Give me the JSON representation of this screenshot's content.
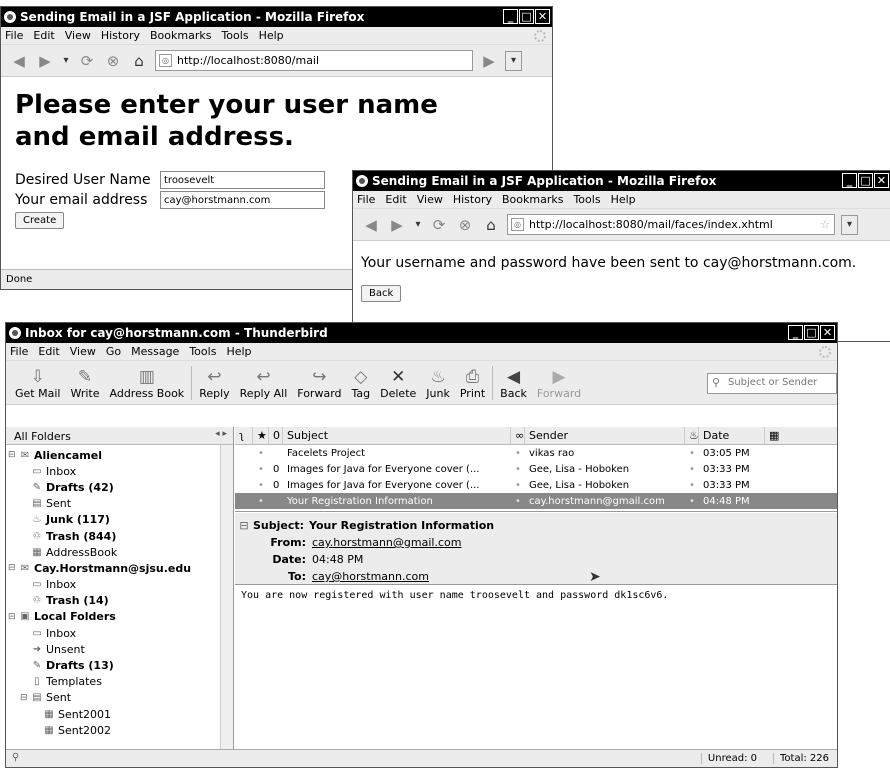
{
  "ff1": {
    "title": "Sending Email in a JSF Application - Mozilla Firefox",
    "menu": [
      "File",
      "Edit",
      "View",
      "History",
      "Bookmarks",
      "Tools",
      "Help"
    ],
    "url": "http://localhost:8080/mail",
    "heading_line1": "Please enter your user name",
    "heading_line2": "and email address.",
    "username_label": "Desired User Name",
    "username_value": "troosevelt",
    "email_label": "Your email address",
    "email_value": "cay@horstmann.com",
    "create_button": "Create",
    "status": "Done"
  },
  "ff2": {
    "title": "Sending Email in a JSF Application - Mozilla Firefox",
    "menu": [
      "File",
      "Edit",
      "View",
      "History",
      "Bookmarks",
      "Tools",
      "Help"
    ],
    "url": "http://localhost:8080/mail/faces/index.xhtml",
    "message": "Your username and password have been sent to cay@horstmann.com.",
    "back_button": "Back"
  },
  "tb": {
    "title": "Inbox for cay@horstmann.com - Thunderbird",
    "menu": [
      "File",
      "Edit",
      "View",
      "Go",
      "Message",
      "Tools",
      "Help"
    ],
    "toolbar": {
      "get_mail": "Get Mail",
      "write": "Write",
      "address_book": "Address Book",
      "reply": "Reply",
      "reply_all": "Reply All",
      "forward": "Forward",
      "tag": "Tag",
      "delete": "Delete",
      "junk": "Junk",
      "print": "Print",
      "back": "Back",
      "forward_nav": "Forward",
      "search_placeholder": "Subject or Sender"
    },
    "folders_header": "All Folders",
    "folders": [
      {
        "label": "Aliencamel",
        "bold": true,
        "level": 0,
        "tw": "⊟",
        "icon": "✉"
      },
      {
        "label": "Inbox",
        "bold": false,
        "level": 1,
        "tw": "",
        "icon": "▭"
      },
      {
        "label": "Drafts (42)",
        "bold": true,
        "level": 1,
        "tw": "",
        "icon": "✎"
      },
      {
        "label": "Sent",
        "bold": false,
        "level": 1,
        "tw": "",
        "icon": "▤"
      },
      {
        "label": "Junk (117)",
        "bold": true,
        "level": 1,
        "tw": "",
        "icon": "♨"
      },
      {
        "label": "Trash (844)",
        "bold": true,
        "level": 1,
        "tw": "",
        "icon": "♲"
      },
      {
        "label": "AddressBook",
        "bold": false,
        "level": 1,
        "tw": "",
        "icon": "▦"
      },
      {
        "label": "Cay.Horstmann@sjsu.edu",
        "bold": true,
        "level": 0,
        "tw": "⊟",
        "icon": "✉"
      },
      {
        "label": "Inbox",
        "bold": false,
        "level": 1,
        "tw": "",
        "icon": "▭"
      },
      {
        "label": "Trash (14)",
        "bold": true,
        "level": 1,
        "tw": "",
        "icon": "♲"
      },
      {
        "label": "Local Folders",
        "bold": true,
        "level": 0,
        "tw": "⊟",
        "icon": "▣"
      },
      {
        "label": "Inbox",
        "bold": false,
        "level": 1,
        "tw": "",
        "icon": "▭"
      },
      {
        "label": "Unsent",
        "bold": false,
        "level": 1,
        "tw": "",
        "icon": "➜"
      },
      {
        "label": "Drafts (13)",
        "bold": true,
        "level": 1,
        "tw": "",
        "icon": "✎"
      },
      {
        "label": "Templates",
        "bold": false,
        "level": 1,
        "tw": "",
        "icon": "▯"
      },
      {
        "label": "Sent",
        "bold": false,
        "level": 1,
        "tw": "⊟",
        "icon": "▤"
      },
      {
        "label": "Sent2001",
        "bold": false,
        "level": 2,
        "tw": "",
        "icon": "▦"
      },
      {
        "label": "Sent2002",
        "bold": false,
        "level": 2,
        "tw": "",
        "icon": "▦"
      }
    ],
    "columns": {
      "subject": "Subject",
      "sender": "Sender",
      "date": "Date"
    },
    "messages": [
      {
        "subject": "Facelets Project",
        "sender": "vikas rao",
        "date": "03:05 PM",
        "attach": "",
        "sel": false
      },
      {
        "subject": "Images for Java for Everyone cover (...",
        "sender": "Gee, Lisa - Hoboken",
        "date": "03:33 PM",
        "attach": "0",
        "sel": false
      },
      {
        "subject": "Images for Java for Everyone cover (...",
        "sender": "Gee, Lisa - Hoboken",
        "date": "03:33 PM",
        "attach": "0",
        "sel": false
      },
      {
        "subject": "Your Registration Information",
        "sender": "cay.horstmann@gmail.com",
        "date": "04:48 PM",
        "attach": "",
        "sel": true
      }
    ],
    "header": {
      "subject_label": "Subject:",
      "subject": "Your Registration Information",
      "from_label": "From:",
      "from": "cay.horstmann@gmail.com",
      "date_label": "Date:",
      "date": "04:48 PM",
      "to_label": "To:",
      "to": "cay@horstmann.com"
    },
    "body": "You are now registered with user name troosevelt and password dk1sc6v6.",
    "status": {
      "unread": "Unread: 0",
      "total": "Total: 226"
    }
  }
}
